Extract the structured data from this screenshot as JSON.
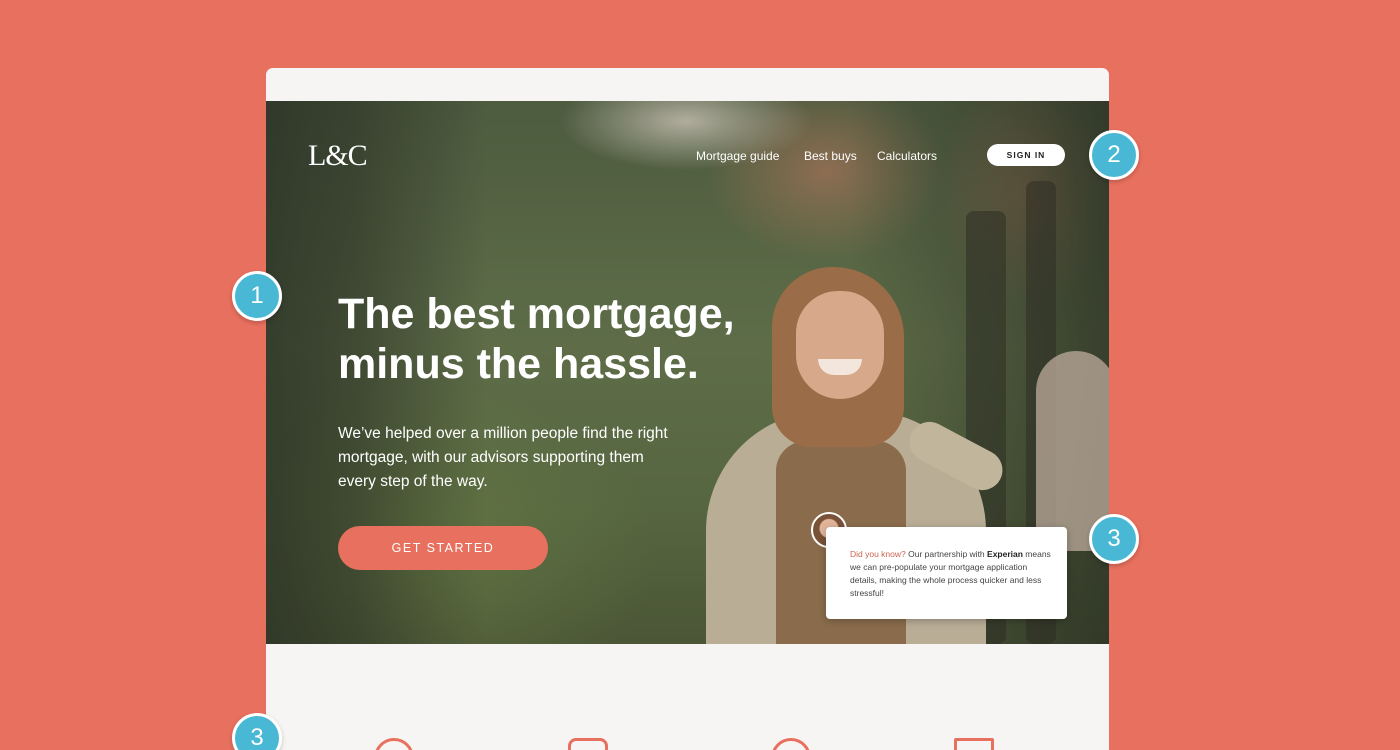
{
  "nav": {
    "logo": "L&C",
    "links": [
      "Mortgage guide",
      "Best buys",
      "Calculators"
    ],
    "signin": "SIGN IN"
  },
  "hero": {
    "headline_line1": "The best mortgage,",
    "headline_line2": "minus the hassle.",
    "subcopy": "We’ve helped over a million people find the right mortgage, with our advisors supporting them every step of the way.",
    "cta": "GET STARTED"
  },
  "tip": {
    "lead": "Did you know?",
    "text_before_brand": " Our partnership with ",
    "brand": "Experian",
    "text_after_brand": " means we can pre-populate your mortgage application details, making the whole process quicker and less stressful!"
  },
  "badges": [
    "1",
    "2",
    "3",
    "3"
  ],
  "colors": {
    "page_bg": "#e8705e",
    "accent": "#e8705e",
    "badge": "#48b8d4"
  }
}
